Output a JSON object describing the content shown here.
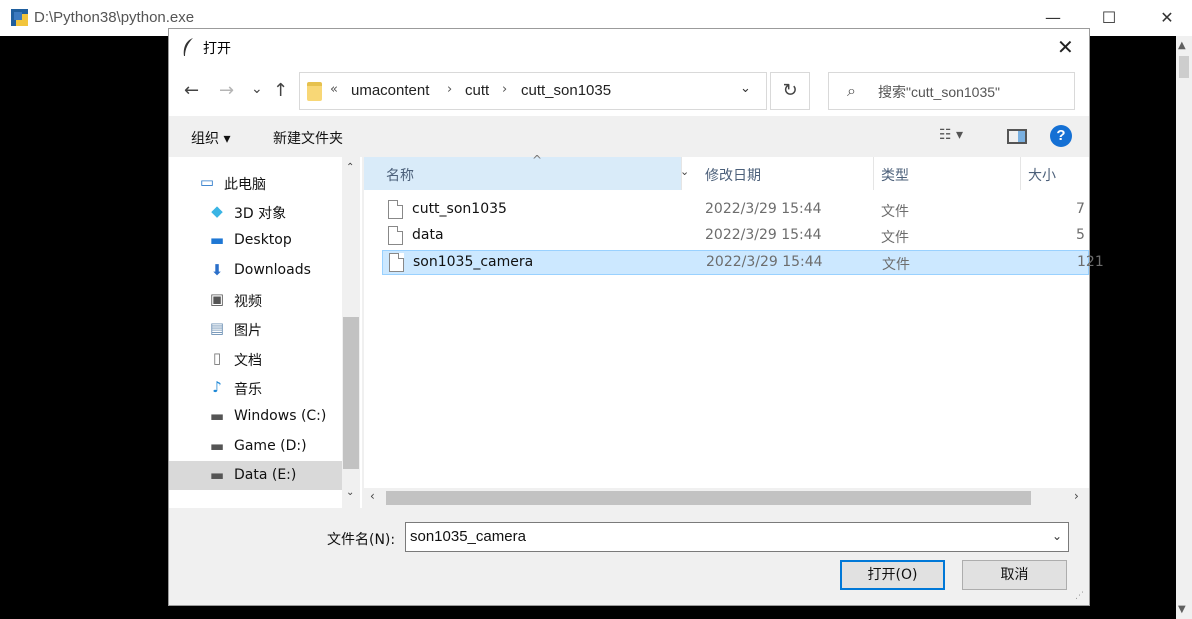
{
  "console": {
    "title": "D:\\Python38\\python.exe",
    "controls": [
      "—",
      "☐",
      "✕"
    ]
  },
  "dialog": {
    "title": "打开",
    "close_glyph": "✕",
    "nav": {
      "back": "←",
      "forward": "→",
      "recent": "⌄",
      "up": "↑"
    },
    "breadcrumb": [
      "«",
      "umacontent",
      "cutt",
      "cutt_son1035"
    ],
    "breadcrumb_sep": "›",
    "address_drop": "⌄",
    "refresh": "↻",
    "search_placeholder": "搜索\"cutt_son1035\"",
    "toolbar": {
      "organize": "组织 ▾",
      "new_folder": "新建文件夹",
      "view": "☷ ▾",
      "help": "?"
    },
    "nav_items": [
      {
        "label": "此电脑",
        "icon": "computer-icon",
        "glyph": "▭",
        "color": "#2b79c9"
      },
      {
        "label": "3D 对象",
        "icon": "3d-objects-icon",
        "glyph": "◆",
        "color": "#3ab4e4"
      },
      {
        "label": "Desktop",
        "icon": "desktop-icon",
        "glyph": "▬",
        "color": "#1e77d4"
      },
      {
        "label": "Downloads",
        "icon": "downloads-icon",
        "glyph": "⬇",
        "color": "#2a6fc9"
      },
      {
        "label": "视频",
        "icon": "videos-icon",
        "glyph": "▣",
        "color": "#555"
      },
      {
        "label": "图片",
        "icon": "pictures-icon",
        "glyph": "▤",
        "color": "#6b8fb3"
      },
      {
        "label": "文档",
        "icon": "documents-icon",
        "glyph": "▯",
        "color": "#777"
      },
      {
        "label": "音乐",
        "icon": "music-icon",
        "glyph": "♪",
        "color": "#1e88d6"
      },
      {
        "label": "Windows (C:)",
        "icon": "drive-c-icon",
        "glyph": "▬",
        "color": "#555"
      },
      {
        "label": "Game (D:)",
        "icon": "drive-d-icon",
        "glyph": "▬",
        "color": "#555"
      },
      {
        "label": "Data (E:)",
        "icon": "drive-e-icon",
        "glyph": "▬",
        "color": "#555"
      }
    ],
    "columns": {
      "name": "名称",
      "modified": "修改日期",
      "type": "类型",
      "size": "大小"
    },
    "files": [
      {
        "name": "cutt_son1035",
        "modified": "2022/3/29 15:44",
        "type": "文件",
        "size": "7"
      },
      {
        "name": "data",
        "modified": "2022/3/29 15:44",
        "type": "文件",
        "size": "5"
      },
      {
        "name": "son1035_camera",
        "modified": "2022/3/29 15:44",
        "type": "文件",
        "size": "121"
      }
    ],
    "filename_label": "文件名(N):",
    "filename_value": "son1035_camera",
    "open_button": "打开(O)",
    "cancel_button": "取消"
  }
}
